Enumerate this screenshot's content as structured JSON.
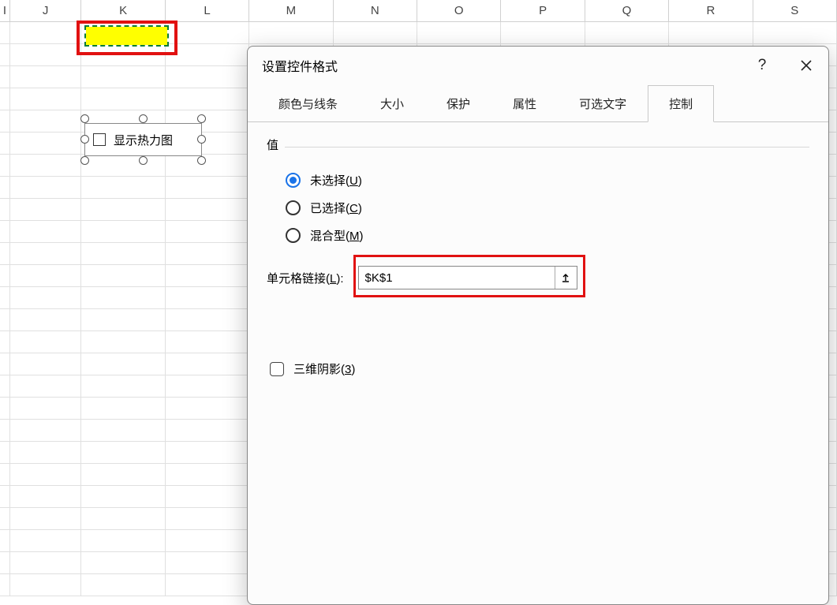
{
  "columns": [
    "I",
    "J",
    "K",
    "L",
    "M",
    "N",
    "O",
    "P",
    "Q",
    "R",
    "S"
  ],
  "highlighted_cell": "K1",
  "control_checkbox": {
    "label": "显示热力图"
  },
  "dialog": {
    "title": "设置控件格式",
    "tabs": {
      "colors_lines": "颜色与线条",
      "size": "大小",
      "protection": "保护",
      "properties": "属性",
      "alt_text": "可选文字",
      "control": "控制"
    },
    "active_tab": "control",
    "value_group_label": "值",
    "radios": {
      "unchecked": {
        "label_pre": "未选择(",
        "key": "U",
        "label_post": ")"
      },
      "checked": {
        "label_pre": "已选择(",
        "key": "C",
        "label_post": ")"
      },
      "mixed": {
        "label_pre": "混合型(",
        "key": "M",
        "label_post": ")"
      }
    },
    "selected_radio": "unchecked",
    "cell_link": {
      "label_pre": "单元格链接(",
      "key": "L",
      "label_post": "):",
      "value": "$K$1"
    },
    "shadow": {
      "label_pre": "三维阴影(",
      "key": "3",
      "label_post": ")"
    }
  }
}
